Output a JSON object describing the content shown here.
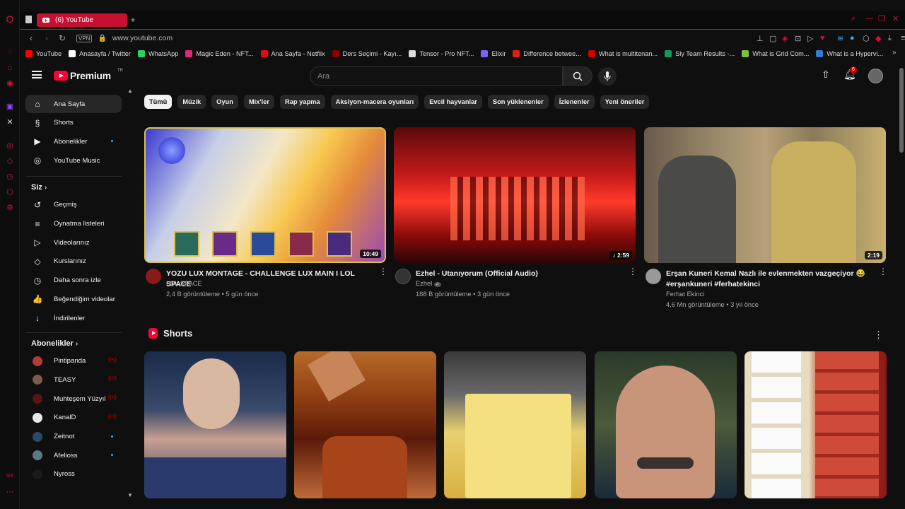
{
  "browser": {
    "tab_title": "(6) YouTube",
    "url": "www.youtube.com",
    "vpn_label": "VPN",
    "bookmarks": [
      {
        "label": "YouTube",
        "color": "#ff0000"
      },
      {
        "label": "Anasayfa / Twitter",
        "color": "#ffffff"
      },
      {
        "label": "WhatsApp",
        "color": "#25d366"
      },
      {
        "label": "Magic Eden - NFT...",
        "color": "#e42575"
      },
      {
        "label": "Ana Sayfa - Netflix",
        "color": "#e50914"
      },
      {
        "label": "Ders Seçimi - Kayı...",
        "color": "#8b0000"
      },
      {
        "label": "Tensor - Pro NFT...",
        "color": "#dddddd"
      },
      {
        "label": "Elixir",
        "color": "#7b61ff"
      },
      {
        "label": "Difference betwee...",
        "color": "#e01e1e"
      },
      {
        "label": "What is multitenan...",
        "color": "#cc0000"
      },
      {
        "label": "Sly Team Results -...",
        "color": "#0f9d58"
      },
      {
        "label": "What is Grid Com...",
        "color": "#7ac142"
      },
      {
        "label": "What is a Hypervi...",
        "color": "#2f7bd6"
      }
    ]
  },
  "header": {
    "logo_text": "Premium",
    "logo_tr": "TR",
    "search_placeholder": "Ara",
    "notification_count": "6"
  },
  "sidebar": {
    "main": [
      {
        "label": "Ana Sayfa",
        "icon": "home-icon",
        "glyph": "⌂"
      },
      {
        "label": "Shorts",
        "icon": "shorts-icon",
        "glyph": "§"
      },
      {
        "label": "Abonelikler",
        "icon": "subscriptions-icon",
        "glyph": "▶"
      },
      {
        "label": "YouTube Music",
        "icon": "music-icon",
        "glyph": "◎"
      }
    ],
    "you_heading": "Siz",
    "you": [
      {
        "label": "Geçmiş",
        "icon": "history-icon",
        "glyph": "↺"
      },
      {
        "label": "Oynatma listeleri",
        "icon": "playlists-icon",
        "glyph": "≡"
      },
      {
        "label": "Videolarınız",
        "icon": "your-videos-icon",
        "glyph": "▷"
      },
      {
        "label": "Kurslarınız",
        "icon": "courses-icon",
        "glyph": "◇"
      },
      {
        "label": "Daha sonra izle",
        "icon": "watch-later-icon",
        "glyph": "◷"
      },
      {
        "label": "Beğendiğim videolar",
        "icon": "liked-icon",
        "glyph": "👍"
      },
      {
        "label": "İndirilenler",
        "icon": "downloads-icon",
        "glyph": "↓"
      }
    ],
    "subs_heading": "Abonelikler",
    "subs": [
      {
        "label": "Pintipanda",
        "avatar": "#b33a3a",
        "status": "live"
      },
      {
        "label": "TEASY",
        "avatar": "#7a5c4a",
        "status": "live"
      },
      {
        "label": "Muhteşem Yüzyıl",
        "avatar": "#5a1515",
        "status": "live"
      },
      {
        "label": "KanalD",
        "avatar": "#e8e8e8",
        "status": "live"
      },
      {
        "label": "Zeitnot",
        "avatar": "#2a4a6a",
        "status": "dot"
      },
      {
        "label": "Afelioss",
        "avatar": "#5a7a8a",
        "status": "dot"
      },
      {
        "label": "Nyross",
        "avatar": "#1a1a1a",
        "status": "none"
      }
    ]
  },
  "chips": [
    "Tümü",
    "Müzik",
    "Oyun",
    "Mix'ler",
    "Rap yapma",
    "Aksiyon-macera oyunları",
    "Evcil hayvanlar",
    "Son yüklenenler",
    "İzlenenler",
    "Yeni öneriler"
  ],
  "videos": [
    {
      "title": "YOZU LUX MONTAGE - CHALLENGE LUX MAIN I LOL SPACE",
      "channel": "LOL SPACE",
      "meta": "2,4 B görüntüleme • 5 gün önce",
      "duration": "10:49",
      "avatar": "#8a1a1a",
      "verified": ""
    },
    {
      "title": "Ezhel - Utanıyorum (Official Audio)",
      "channel": "Ezhel",
      "meta": "188 B görüntüleme • 3 gün önce",
      "duration": "♪ 2:59",
      "avatar": "#333333",
      "verified": "✓"
    },
    {
      "title": "Erşan Kuneri Kemal Nazlı ile evlenmekten vazgeçiyor 😂 #erşankuneri #ferhatekinci",
      "channel": "Ferhat Ekinci",
      "meta": "4,6 Mn görüntüleme • 3 yıl önce",
      "duration": "2:19",
      "avatar": "#999999",
      "verified": ""
    }
  ],
  "shorts_heading": "Shorts"
}
